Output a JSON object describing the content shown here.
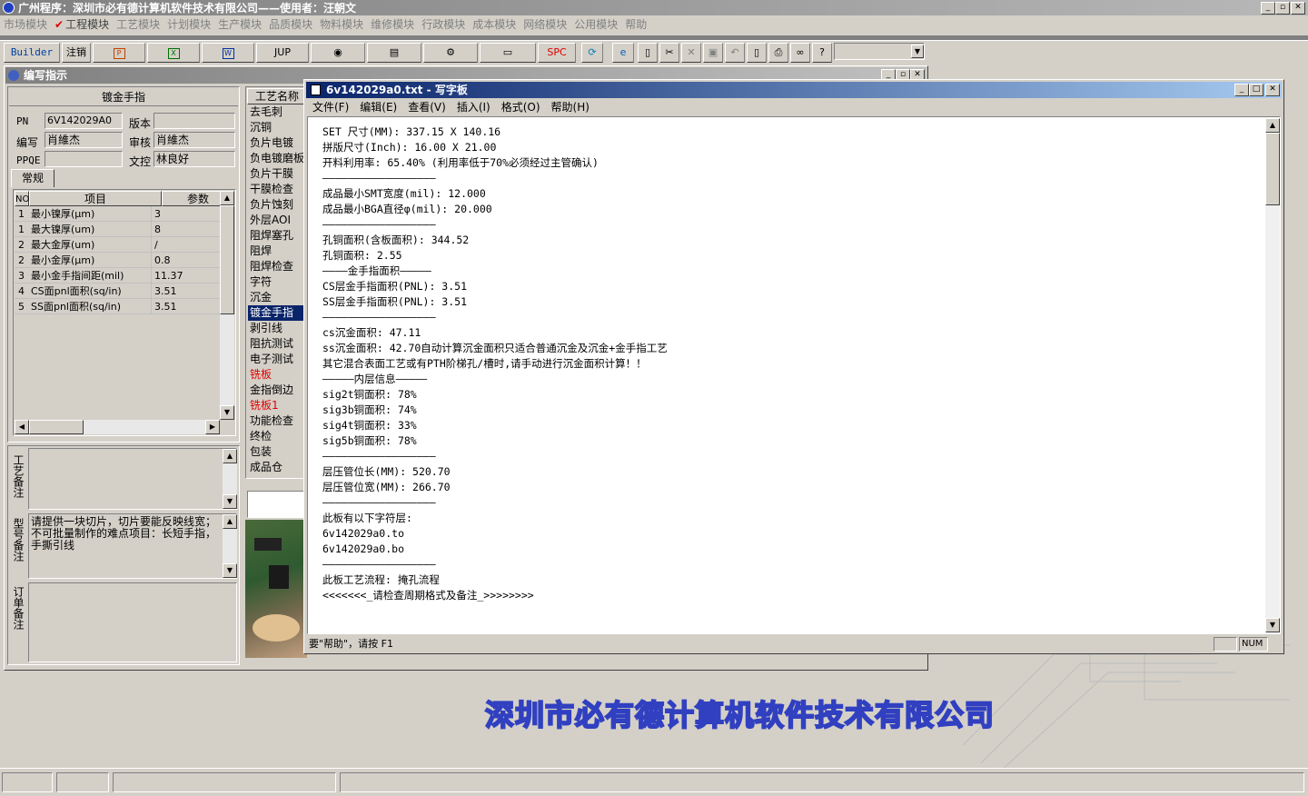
{
  "app": {
    "title": "广州程序：深圳市必有德计算机软件技术有限公司——使用者：汪朝文",
    "menu": [
      "市场模块",
      "工程模块",
      "工艺模块",
      "计划模块",
      "生产模块",
      "品质模块",
      "物料模块",
      "维修模块",
      "行政模块",
      "成本模块",
      "网络模块",
      "公用模块",
      "帮助"
    ],
    "toolbar": {
      "builder": "Builder",
      "logout": "注销",
      "jup": "JUP",
      "spc": "SPC"
    },
    "company_banner": "深圳市必有德计算机软件技术有限公司"
  },
  "editor": {
    "title": "编写指示",
    "header": "镀金手指",
    "pn_label": "PN",
    "pn_value": "6V142029A0",
    "version_label": "版本",
    "version_value": "",
    "writer_label": "编写",
    "writer_value": "肖維杰",
    "review_label": "审核",
    "review_value": "肖維杰",
    "ppqe_label": "PPQE",
    "ppqe_value": "",
    "doc_label": "文控",
    "doc_value": "林良好",
    "tab_general": "常规",
    "grid_headers": [
      "NO",
      "项目",
      "参数"
    ],
    "grid_rows": [
      {
        "no": "1",
        "item": "最小镍厚(μm)",
        "param": "3"
      },
      {
        "no": "1",
        "item": "最大镍厚(um)",
        "param": "8"
      },
      {
        "no": "2",
        "item": "最大金厚(um)",
        "param": "/"
      },
      {
        "no": "2",
        "item": "最小金厚(μm)",
        "param": "0.8"
      },
      {
        "no": "3",
        "item": "最小金手指间距(mil)",
        "param": "11.37"
      },
      {
        "no": "4",
        "item": "CS面pnl面积(sq/in)",
        "param": "3.51"
      },
      {
        "no": "5",
        "item": "SS面pnl面积(sq/in)",
        "param": "3.51"
      }
    ],
    "note1_label": "工艺备注",
    "note2_label": "型号备注",
    "note2_text": "请提供一块切片，切片要能反映线宽；不可批量制作的难点项目：长短手指，手撕引线",
    "note3_label": "订单备注",
    "process_header": "工艺名称",
    "processes": [
      {
        "name": "去毛刺",
        "style": ""
      },
      {
        "name": "沉铜",
        "style": ""
      },
      {
        "name": "负片电镀",
        "style": ""
      },
      {
        "name": "负电镀磨板",
        "style": ""
      },
      {
        "name": "负片干膜",
        "style": ""
      },
      {
        "name": "干膜检查",
        "style": ""
      },
      {
        "name": "负片蚀刻",
        "style": ""
      },
      {
        "name": "外层AOI",
        "style": ""
      },
      {
        "name": "阻焊塞孔",
        "style": ""
      },
      {
        "name": "阻焊",
        "style": ""
      },
      {
        "name": "阻焊检查",
        "style": ""
      },
      {
        "name": "字符",
        "style": ""
      },
      {
        "name": "沉金",
        "style": ""
      },
      {
        "name": "镀金手指",
        "style": "sel"
      },
      {
        "name": "剥引线",
        "style": ""
      },
      {
        "name": "阻抗测试",
        "style": ""
      },
      {
        "name": "电子测试",
        "style": ""
      },
      {
        "name": "铣板",
        "style": "red"
      },
      {
        "name": "金指倒边",
        "style": ""
      },
      {
        "name": "铣板1",
        "style": "red"
      },
      {
        "name": "功能检查",
        "style": ""
      },
      {
        "name": "终检",
        "style": ""
      },
      {
        "name": "包装",
        "style": ""
      },
      {
        "name": "成品仓",
        "style": ""
      }
    ]
  },
  "wordpad": {
    "title": "6v142029a0.txt - 写字板",
    "menu": [
      "文件(F)",
      "编辑(E)",
      "查看(V)",
      "插入(I)",
      "格式(O)",
      "帮助(H)"
    ],
    "lines": [
      "SET 尺寸(MM): 337.15 X 140.16",
      "拼版尺寸(Inch): 16.00 X 21.00",
      "开料利用率: 65.40% (利用率低于70%必须经过主管确认)",
      "——————————————————",
      "成品最小SMT宽度(mil): 12.000",
      "成品最小BGA直径φ(mil): 20.000",
      "——————————————————",
      "孔铜面积(含板面积): 344.52",
      "孔铜面积: 2.55",
      "————金手指面积—————",
      "CS层金手指面积(PNL): 3.51",
      "SS层金手指面积(PNL): 3.51",
      "——————————————————",
      "cs沉金面积: 47.11",
      "ss沉金面积: 42.70自动计算沉金面积只适合普通沉金及沉金+金手指工艺",
      "其它混合表面工艺或有PTH阶梯孔/槽时,请手动进行沉金面积计算！！",
      "—————内层信息—————",
      "sig2t铜面积: 78%",
      "sig3b铜面积: 74%",
      "sig4t铜面积: 33%",
      "sig5b铜面积: 78%",
      "——————————————————",
      "层压管位长(MM): 520.70",
      "层压管位宽(MM): 266.70",
      "——————————————————",
      "此板有以下字符层:",
      "6v142029a0.to",
      "6v142029a0.bo",
      "——————————————————",
      "此板工艺流程: 掩孔流程",
      "<<<<<<<_请检查周期格式及备注_>>>>>>>>"
    ],
    "status_help": "要\"帮助\"，请按 F1",
    "status_num": "NUM"
  }
}
